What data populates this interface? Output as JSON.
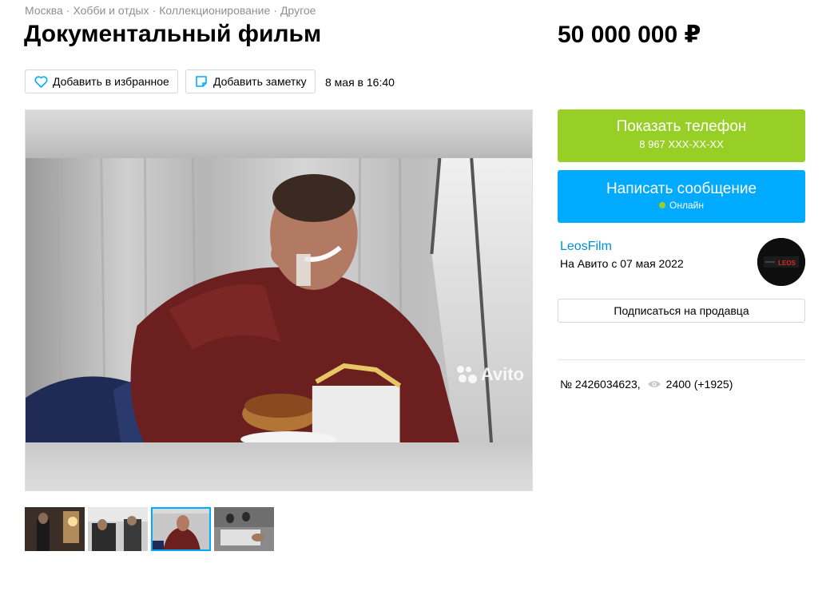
{
  "breadcrumbs": [
    "Москва",
    "Хобби и отдых",
    "Коллекционирование",
    "Другое"
  ],
  "breadcrumb_separator": "·",
  "listing": {
    "title": "Документальный фильм",
    "price": "50 000 000 ₽",
    "date": "8 мая в 16:40",
    "number": "№ 2426034623,",
    "views": "2400 (+1925)"
  },
  "actions": {
    "favorite_label": "Добавить в избранное",
    "favorite_icon": "heart-icon",
    "note_label": "Добавить заметку",
    "note_icon": "note-icon"
  },
  "contact": {
    "phone_label": "Показать телефон",
    "phone_masked": "8 967 XXX-XX-XX",
    "message_label": "Написать сообщение",
    "online_status": "Онлайн"
  },
  "seller": {
    "name": "LeosFilm",
    "since": "На Авито с 07 мая 2022",
    "avatar_text": "LEOS",
    "subscribe_label": "Подписаться на продавца"
  },
  "gallery": {
    "watermark": "Avito",
    "thumbnail_count": 4,
    "active_index": 2
  },
  "colors": {
    "phone_button": "#97cf26",
    "message_button": "#00aaff",
    "link": "#0091d9",
    "online": "#97cf26"
  }
}
